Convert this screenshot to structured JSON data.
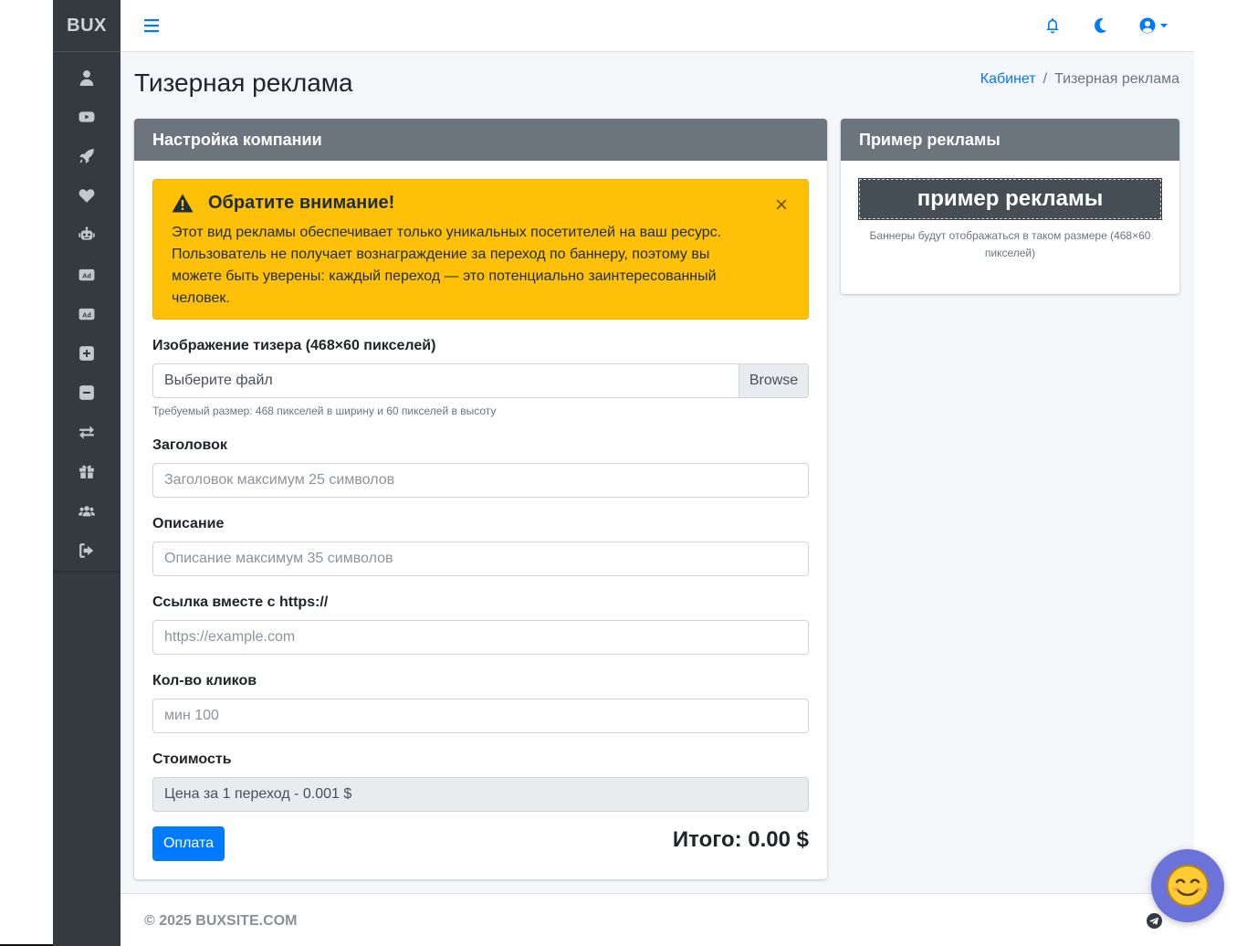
{
  "brand": "BUX",
  "sidebar": {
    "items": [
      {
        "icon": "user-icon"
      },
      {
        "icon": "youtube-icon"
      },
      {
        "icon": "rocket-icon"
      },
      {
        "icon": "heart-icon"
      },
      {
        "icon": "robot-icon"
      },
      {
        "icon": "ad-icon"
      },
      {
        "icon": "ad-icon"
      },
      {
        "icon": "plus-square-icon"
      },
      {
        "icon": "minus-square-icon"
      },
      {
        "icon": "exchange-icon"
      },
      {
        "icon": "gift-icon"
      },
      {
        "icon": "users-icon"
      },
      {
        "icon": "sign-out-icon"
      }
    ]
  },
  "topbar": {
    "icons": [
      "menu-icon",
      "bell-icon",
      "moon-icon",
      "user-circle-icon"
    ]
  },
  "page": {
    "title": "Тизерная реклама",
    "breadcrumb": {
      "home": "Кабинет",
      "separator": "/",
      "current": "Тизерная реклама"
    }
  },
  "settings_card": {
    "header": "Настройка компании",
    "alert": {
      "title": "Обратите внимание!",
      "close": "×",
      "text": "Этот вид рекламы обеспечивает только уникальных посетителей на ваш ресурс. Пользователь не получает вознаграждение за переход по баннеру, поэтому вы можете быть уверены: каждый переход — это потенциально заинтересованный человек."
    },
    "image": {
      "label": "Изображение тизера (468×60 пикселей)",
      "file_text": "Выберите файл",
      "browse": "Browse",
      "help": "Требуемый размер: 468 пикселей в ширину и 60 пикселей в высоту"
    },
    "title_field": {
      "label": "Заголовок",
      "placeholder": "Заголовок максимум 25 символов"
    },
    "description_field": {
      "label": "Описание",
      "placeholder": "Описание максимум 35 символов"
    },
    "link_field": {
      "label": "Ссылка вместе с https://",
      "placeholder": "https://example.com"
    },
    "clicks_field": {
      "label": "Кол-во кликов",
      "placeholder": "мин 100"
    },
    "cost_field": {
      "label": "Стоимость",
      "value": "Цена за 1 переход - 0.001 $"
    },
    "pay_button": "Оплата",
    "total": "Итого: 0.00 $"
  },
  "example_card": {
    "header": "Пример рекламы",
    "banner_text": "пример рекламы",
    "note": "Баннеры будут отображаться в таком размере (468×60 пикселей)"
  },
  "footer": {
    "text": "© 2025 BUXSITE.COM"
  },
  "colors": {
    "primary": "#007bff",
    "sidebar": "#343a40",
    "card_header": "#6c757d",
    "warning": "#ffc107"
  }
}
